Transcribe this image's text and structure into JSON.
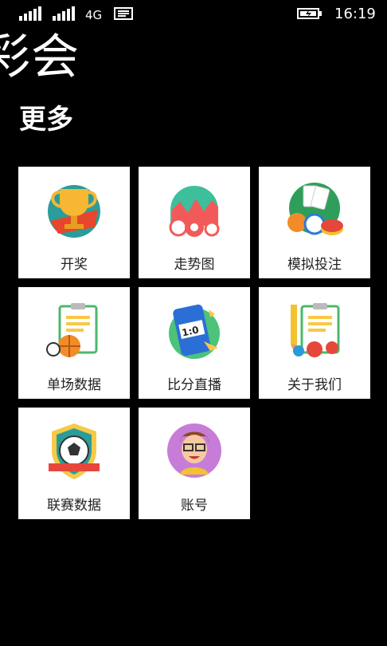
{
  "status_bar": {
    "network": "4G",
    "time": "16:19",
    "icons": [
      "signal-icon",
      "signal-icon",
      "message-icon",
      "battery-charging-icon"
    ]
  },
  "app": {
    "title": "彩会"
  },
  "page": {
    "title": "更多"
  },
  "tiles": [
    {
      "label": "开奖",
      "icon": "trophy-icon"
    },
    {
      "label": "走势图",
      "icon": "trend-chart-icon"
    },
    {
      "label": "模拟投注",
      "icon": "cards-chips-icon"
    },
    {
      "label": "单场数据",
      "icon": "clipboard-basketball-icon"
    },
    {
      "label": "比分直播",
      "icon": "scoreboard-phone-icon"
    },
    {
      "label": "关于我们",
      "icon": "clipboard-pencil-icon"
    },
    {
      "label": "联赛数据",
      "icon": "soccer-shield-icon"
    },
    {
      "label": "账号",
      "icon": "user-avatar-icon"
    }
  ]
}
